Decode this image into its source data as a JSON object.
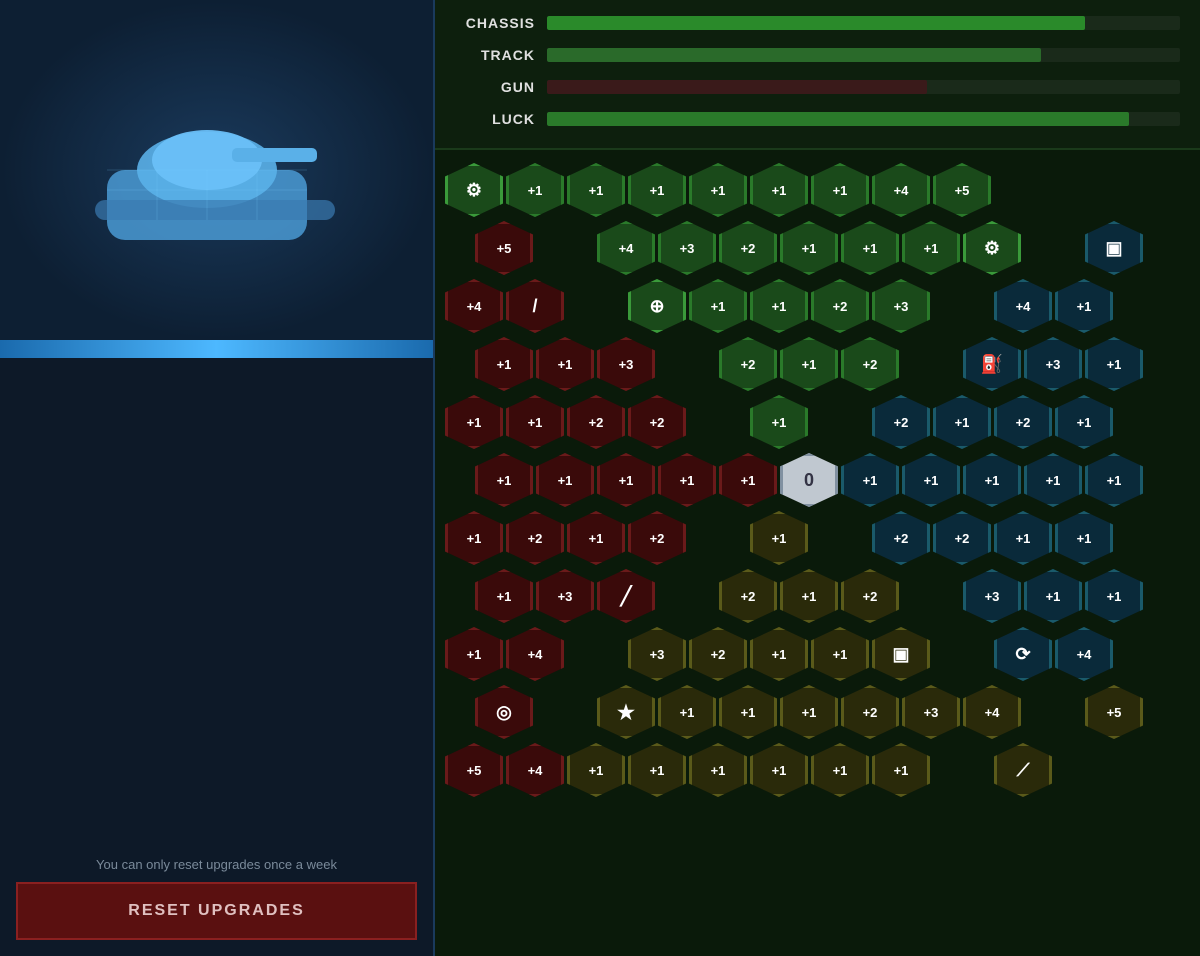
{
  "left_panel": {
    "reset_hint": "You can only reset upgrades once a week",
    "reset_button_label": "RESET UPGRADES"
  },
  "stat_bars": {
    "items": [
      {
        "label": "CHASSIS",
        "value": 85
      },
      {
        "label": "TRACK",
        "value": 78
      },
      {
        "label": "GUN",
        "value": 60
      },
      {
        "label": "LUCK",
        "value": 92
      }
    ]
  },
  "grid": {
    "center_value": "0",
    "rows": [
      [
        {
          "type": "icon",
          "color": "green",
          "icon": "⬡",
          "label": "chip"
        },
        {
          "type": "val",
          "color": "green",
          "val": "+1"
        },
        {
          "type": "val",
          "color": "green",
          "val": "+1"
        },
        {
          "type": "val",
          "color": "green",
          "val": "+1"
        },
        {
          "type": "val",
          "color": "green",
          "val": "+1"
        },
        {
          "type": "val",
          "color": "green",
          "val": "+1"
        },
        {
          "type": "val",
          "color": "green",
          "val": "+1"
        },
        {
          "type": "val",
          "color": "green",
          "val": "+4"
        },
        {
          "type": "val",
          "color": "green",
          "val": "+5"
        }
      ],
      [
        {
          "type": "val",
          "color": "red",
          "val": "+5"
        },
        {
          "type": "empty"
        },
        {
          "type": "val",
          "color": "green",
          "val": "+4"
        },
        {
          "type": "val",
          "color": "green",
          "val": "+3"
        },
        {
          "type": "val",
          "color": "green",
          "val": "+2"
        },
        {
          "type": "val",
          "color": "green",
          "val": "+1"
        },
        {
          "type": "val",
          "color": "green",
          "val": "+1"
        },
        {
          "type": "val",
          "color": "green",
          "val": "+1"
        },
        {
          "type": "icon",
          "color": "green",
          "icon": "⚙",
          "label": "gear"
        },
        {
          "type": "empty"
        },
        {
          "type": "icon",
          "color": "teal",
          "icon": "🪣",
          "label": "fuel-can"
        }
      ],
      [
        {
          "type": "val",
          "color": "red",
          "val": "+4"
        },
        {
          "type": "icon",
          "color": "red",
          "icon": "🔫",
          "label": "gun"
        },
        {
          "type": "empty"
        },
        {
          "type": "icon",
          "color": "green",
          "icon": "🛡",
          "label": "shield"
        },
        {
          "type": "val",
          "color": "green",
          "val": "+1"
        },
        {
          "type": "val",
          "color": "green",
          "val": "+1"
        },
        {
          "type": "val",
          "color": "green",
          "val": "+2"
        },
        {
          "type": "val",
          "color": "green",
          "val": "+3"
        },
        {
          "type": "empty"
        },
        {
          "type": "val",
          "color": "teal",
          "val": "+4"
        },
        {
          "type": "val",
          "color": "teal",
          "val": "+1"
        }
      ],
      [
        {
          "type": "val",
          "color": "red",
          "val": "+1"
        },
        {
          "type": "val",
          "color": "red",
          "val": "+1"
        },
        {
          "type": "val",
          "color": "red",
          "val": "+3"
        },
        {
          "type": "empty"
        },
        {
          "type": "val",
          "color": "green",
          "val": "+2"
        },
        {
          "type": "val",
          "color": "green",
          "val": "+1"
        },
        {
          "type": "val",
          "color": "green",
          "val": "+2"
        },
        {
          "type": "empty"
        },
        {
          "type": "icon",
          "color": "teal",
          "icon": "⛽",
          "label": "fuel"
        },
        {
          "type": "val",
          "color": "teal",
          "val": "+3"
        },
        {
          "type": "val",
          "color": "teal",
          "val": "+1"
        }
      ],
      [
        {
          "type": "val",
          "color": "red",
          "val": "+1"
        },
        {
          "type": "val",
          "color": "red",
          "val": "+1"
        },
        {
          "type": "val",
          "color": "red",
          "val": "+2"
        },
        {
          "type": "val",
          "color": "red",
          "val": "+2"
        },
        {
          "type": "empty"
        },
        {
          "type": "val",
          "color": "green",
          "val": "+1"
        },
        {
          "type": "empty"
        },
        {
          "type": "val",
          "color": "teal",
          "val": "+2"
        },
        {
          "type": "val",
          "color": "teal",
          "val": "+1"
        },
        {
          "type": "val",
          "color": "teal",
          "val": "+2"
        },
        {
          "type": "val",
          "color": "teal",
          "val": "+1"
        }
      ],
      [
        {
          "type": "val",
          "color": "red",
          "val": "+1"
        },
        {
          "type": "val",
          "color": "red",
          "val": "+1"
        },
        {
          "type": "val",
          "color": "red",
          "val": "+1"
        },
        {
          "type": "val",
          "color": "red",
          "val": "+1"
        },
        {
          "type": "val",
          "color": "red",
          "val": "+1"
        },
        {
          "type": "center",
          "val": "0"
        },
        {
          "type": "val",
          "color": "teal",
          "val": "+1"
        },
        {
          "type": "val",
          "color": "teal",
          "val": "+1"
        },
        {
          "type": "val",
          "color": "teal",
          "val": "+1"
        },
        {
          "type": "val",
          "color": "teal",
          "val": "+1"
        },
        {
          "type": "val",
          "color": "teal",
          "val": "+1"
        }
      ],
      [
        {
          "type": "val",
          "color": "red",
          "val": "+1"
        },
        {
          "type": "val",
          "color": "red",
          "val": "+2"
        },
        {
          "type": "val",
          "color": "red",
          "val": "+1"
        },
        {
          "type": "val",
          "color": "red",
          "val": "+2"
        },
        {
          "type": "empty"
        },
        {
          "type": "val",
          "color": "olive",
          "val": "+1"
        },
        {
          "type": "empty"
        },
        {
          "type": "val",
          "color": "teal",
          "val": "+2"
        },
        {
          "type": "val",
          "color": "teal",
          "val": "+2"
        },
        {
          "type": "val",
          "color": "teal",
          "val": "+1"
        },
        {
          "type": "val",
          "color": "teal",
          "val": "+1"
        }
      ],
      [
        {
          "type": "val",
          "color": "red",
          "val": "+1"
        },
        {
          "type": "val",
          "color": "red",
          "val": "+3"
        },
        {
          "type": "icon",
          "color": "red",
          "icon": "╱",
          "label": "slash"
        },
        {
          "type": "empty"
        },
        {
          "type": "val",
          "color": "olive",
          "val": "+2"
        },
        {
          "type": "val",
          "color": "olive",
          "val": "+1"
        },
        {
          "type": "val",
          "color": "olive",
          "val": "+2"
        },
        {
          "type": "empty"
        },
        {
          "type": "val",
          "color": "teal",
          "val": "+3"
        },
        {
          "type": "val",
          "color": "teal",
          "val": "+1"
        },
        {
          "type": "val",
          "color": "teal",
          "val": "+1"
        }
      ],
      [
        {
          "type": "val",
          "color": "red",
          "val": "+1"
        },
        {
          "type": "val",
          "color": "red",
          "val": "+4"
        },
        {
          "type": "empty"
        },
        {
          "type": "val",
          "color": "olive",
          "val": "+3"
        },
        {
          "type": "val",
          "color": "olive",
          "val": "+2"
        },
        {
          "type": "val",
          "color": "olive",
          "val": "+1"
        },
        {
          "type": "val",
          "color": "olive",
          "val": "+1"
        },
        {
          "type": "icon",
          "color": "olive",
          "icon": "🛡",
          "label": "shield2"
        },
        {
          "type": "empty"
        },
        {
          "type": "icon",
          "color": "teal",
          "icon": "🐌",
          "label": "slow"
        },
        {
          "type": "val",
          "color": "teal",
          "val": "+4"
        }
      ],
      [
        {
          "type": "icon",
          "color": "red",
          "icon": "◎",
          "label": "target"
        },
        {
          "type": "empty"
        },
        {
          "type": "icon",
          "color": "olive",
          "icon": "⭐",
          "label": "star"
        },
        {
          "type": "val",
          "color": "olive",
          "val": "+1"
        },
        {
          "type": "val",
          "color": "olive",
          "val": "+1"
        },
        {
          "type": "val",
          "color": "olive",
          "val": "+1"
        },
        {
          "type": "val",
          "color": "olive",
          "val": "+2"
        },
        {
          "type": "val",
          "color": "olive",
          "val": "+3"
        },
        {
          "type": "val",
          "color": "olive",
          "val": "+4"
        },
        {
          "type": "empty"
        },
        {
          "type": "val",
          "color": "olive",
          "val": "+5"
        }
      ],
      [
        {
          "type": "val",
          "color": "red",
          "val": "+5"
        },
        {
          "type": "val",
          "color": "red",
          "val": "+4"
        },
        {
          "type": "val",
          "color": "olive",
          "val": "+1"
        },
        {
          "type": "val",
          "color": "olive",
          "val": "+1"
        },
        {
          "type": "val",
          "color": "olive",
          "val": "+1"
        },
        {
          "type": "val",
          "color": "olive",
          "val": "+1"
        },
        {
          "type": "val",
          "color": "olive",
          "val": "+1"
        },
        {
          "type": "val",
          "color": "olive",
          "val": "+1"
        },
        {
          "type": "empty"
        },
        {
          "type": "icon",
          "color": "olive",
          "icon": "🔧",
          "label": "wrench"
        }
      ]
    ]
  }
}
